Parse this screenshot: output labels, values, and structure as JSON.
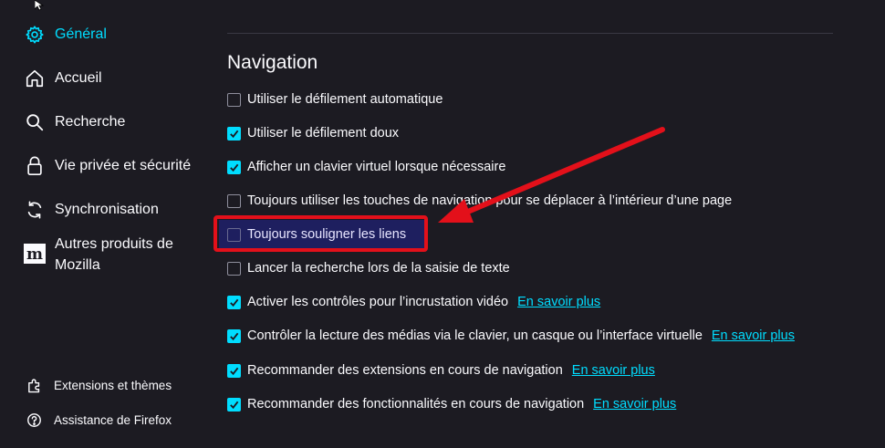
{
  "sidebar": {
    "items": [
      {
        "label": "Général",
        "icon": "gear-icon",
        "active": true
      },
      {
        "label": "Accueil",
        "icon": "home-icon"
      },
      {
        "label": "Recherche",
        "icon": "search-icon"
      },
      {
        "label": "Vie privée et sécurité",
        "icon": "lock-icon"
      },
      {
        "label": "Synchronisation",
        "icon": "sync-icon"
      },
      {
        "label": "Autres produits de\nMozilla",
        "icon": "mozilla-m-icon"
      }
    ],
    "footer": [
      {
        "label": "Extensions et thèmes",
        "icon": "puzzle-icon"
      },
      {
        "label": "Assistance de Firefox",
        "icon": "help-icon"
      }
    ]
  },
  "section": {
    "title": "Navigation",
    "options": [
      {
        "label": "Utiliser le défilement automatique",
        "checked": false
      },
      {
        "label": "Utiliser le défilement doux",
        "checked": true
      },
      {
        "label": "Afficher un clavier virtuel lorsque nécessaire",
        "checked": true
      },
      {
        "label": "Toujours utiliser les touches de navigation pour se déplacer à l’intérieur d’une page",
        "checked": false
      },
      {
        "label": "Toujours souligner les liens",
        "checked": false,
        "highlighted": true
      },
      {
        "label": "Lancer la recherche lors de la saisie de texte",
        "checked": false
      },
      {
        "label": "Activer les contrôles pour l’incrustation vidéo",
        "checked": true,
        "link": "En savoir plus"
      },
      {
        "label": "Contrôler la lecture des médias via le clavier, un casque ou l’interface virtuelle",
        "checked": true,
        "link": "En savoir plus"
      },
      {
        "label": "Recommander des extensions en cours de navigation",
        "checked": true,
        "link": "En savoir plus"
      },
      {
        "label": "Recommander des fonctionnalités en cours de navigation",
        "checked": true,
        "link": "En savoir plus"
      }
    ]
  },
  "colors": {
    "accent": "#00ddff",
    "background": "#1c1b22",
    "annotation": "#e3101a",
    "highlight": "#1e1f5f"
  }
}
